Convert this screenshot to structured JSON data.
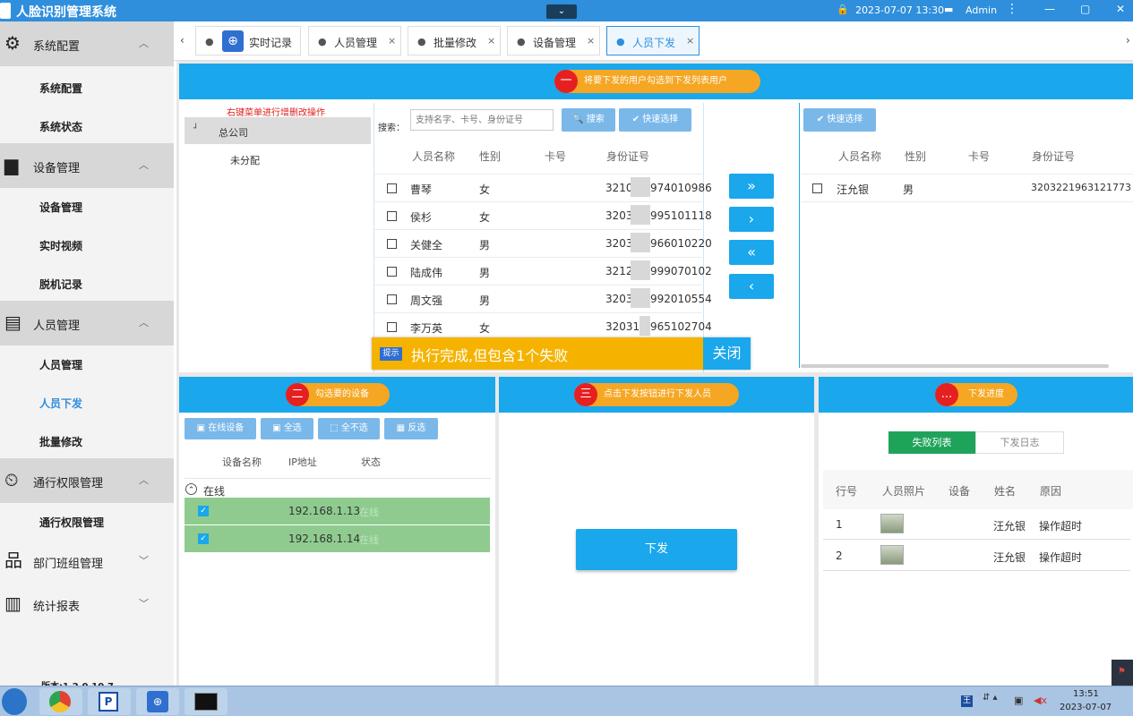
{
  "titlebar": {
    "title": "人脸识别管理系统",
    "dropdown_glyph": "⌄",
    "datetime": "2023-07-07 13:30",
    "user": "Admin",
    "more": "⋮",
    "minimize": "—",
    "restore": "▢",
    "close": "✕"
  },
  "sidebar": {
    "groups": [
      {
        "label": "系统配置",
        "icon": "⚙",
        "icon_name": "gear-icon",
        "chevron": "︿",
        "items": [
          "系统配置",
          "系统状态"
        ]
      },
      {
        "label": "设备管理",
        "icon": "▆",
        "icon_name": "monitor-icon",
        "chevron": "︿",
        "items": [
          "设备管理",
          "实时视频",
          "脱机记录"
        ]
      },
      {
        "label": "人员管理",
        "icon": "▤",
        "icon_name": "id-card-icon",
        "chevron": "︿",
        "items": [
          "人员管理",
          "人员下发",
          "批量修改"
        ]
      },
      {
        "label": "通行权限管理",
        "icon": "⏲",
        "icon_name": "person-clock-icon",
        "chevron": "︿",
        "items": [
          "通行权限管理"
        ]
      },
      {
        "label": "部门班组管理",
        "icon": "品",
        "icon_name": "org-chart-icon",
        "chevron": "﹀",
        "items": []
      },
      {
        "label": "统计报表",
        "icon": "▥",
        "icon_name": "bar-chart-icon",
        "chevron": "﹀",
        "items": []
      }
    ],
    "active_item": "人员下发",
    "version_text": "版本:1.2.0.10.7"
  },
  "tabs": {
    "left_arrow": "‹",
    "right_arrow": "›",
    "dot": "●",
    "close": "×",
    "items": [
      {
        "label": "实时记录",
        "closable": false
      },
      {
        "label": "人员管理",
        "closable": true
      },
      {
        "label": "批量修改",
        "closable": true
      },
      {
        "label": "设备管理",
        "closable": true
      },
      {
        "label": "人员下发",
        "closable": true,
        "active": true
      }
    ]
  },
  "step1": {
    "num": "一",
    "title": "将要下发的用户勾选到下发列表用户",
    "tree_hint": "右键菜单进行增删改操作",
    "tree_expander": "┘",
    "tree": [
      "总公司",
      "未分配"
    ],
    "search_label": "搜索：",
    "search_placeholder": "支持名字、卡号、身份证号",
    "search_button": "搜索",
    "quick_select": "快速选择",
    "columns": [
      "人员名称",
      "性别",
      "卡号",
      "身份证号"
    ],
    "people": [
      {
        "name": "曹琴",
        "gender": "女",
        "card": "",
        "id": "3210",
        "id_tail": "974010986"
      },
      {
        "name": "侯杉",
        "gender": "女",
        "card": "",
        "id": "3203",
        "id_tail": "995101118"
      },
      {
        "name": "关健全",
        "gender": "男",
        "card": "",
        "id": "3203",
        "id_tail": "966010220"
      },
      {
        "name": "陆成伟",
        "gender": "男",
        "card": "",
        "id": "3212",
        "id_tail": "999070102"
      },
      {
        "name": "周文强",
        "gender": "男",
        "card": "",
        "id": "3203",
        "id_tail": "992010554"
      },
      {
        "name": "李万英",
        "gender": "女",
        "card": "",
        "id": "32031",
        "id_tail": "965102704"
      }
    ],
    "transfer_buttons": [
      "»",
      "›",
      "«",
      "‹"
    ],
    "right_quick_select": "快速选择",
    "right_columns": [
      "人员名称",
      "性别",
      "卡号",
      "身份证号"
    ],
    "selected": [
      {
        "name": "汪允银",
        "gender": "男",
        "card": "",
        "id": "3203221963121773"
      }
    ]
  },
  "toast": {
    "badge": "提示",
    "message": "执行完成,但包含1个失败",
    "close": "关闭"
  },
  "step2": {
    "num": "二",
    "title": "勾选要的设备",
    "buttons": [
      "在线设备",
      "全选",
      "全不选",
      "反选"
    ],
    "columns": [
      "设备名称",
      "IP地址",
      "状态"
    ],
    "group_toggle": "⌃",
    "group": "在线",
    "devices": [
      {
        "name": "",
        "ip": "192.168.1.13",
        "status": "在线",
        "checked": true
      },
      {
        "name": "",
        "ip": "192.168.1.14",
        "status": "在线",
        "checked": true
      }
    ]
  },
  "step3": {
    "num": "三",
    "title": "点击下发按钮进行下发人员",
    "button": "下发"
  },
  "progress": {
    "num": "...",
    "title": "下发进度",
    "tabs": [
      "失败列表",
      "下发日志"
    ],
    "columns": [
      "行号",
      "人员照片",
      "设备",
      "姓名",
      "原因"
    ],
    "rows": [
      {
        "no": "1",
        "device": "",
        "name": "汪允银",
        "reason": "操作超时"
      },
      {
        "no": "2",
        "device": "",
        "name": "汪允银",
        "reason": "操作超时"
      }
    ]
  },
  "taskbar": {
    "clock_time": "13:51",
    "clock_date": "2023-07-07",
    "ime": "王"
  },
  "colors": {
    "primary": "#1aa7ec",
    "accent_orange": "#f5a623",
    "step_red": "#e62020",
    "online_green": "#8fcb8f",
    "toast_bg": "#f5b300"
  }
}
